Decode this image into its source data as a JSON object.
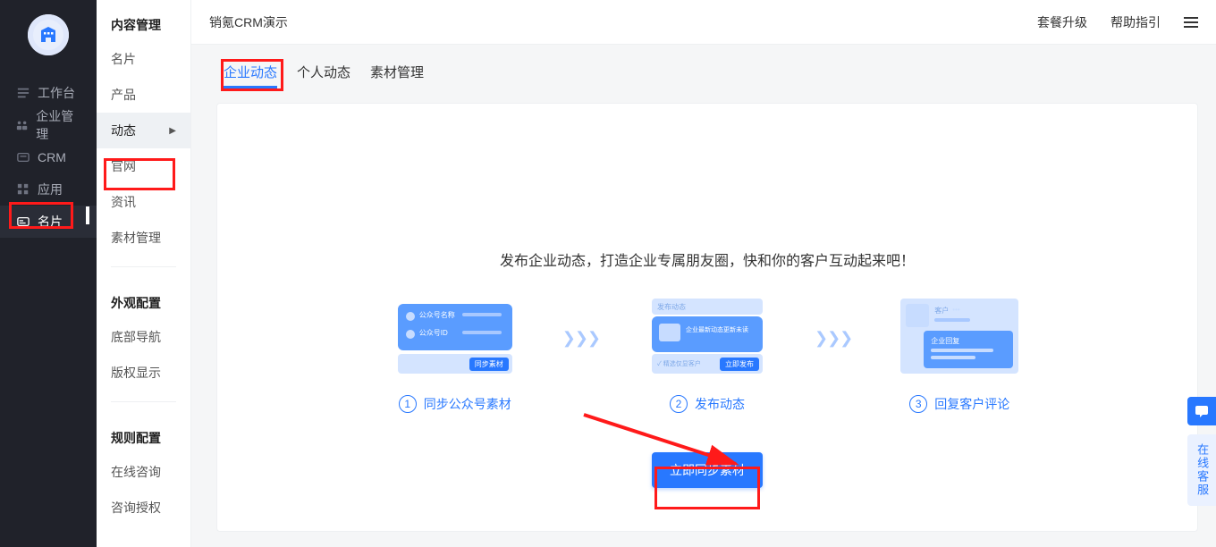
{
  "brand": "销氪CRM演示",
  "top_right": {
    "upgrade": "套餐升级",
    "help": "帮助指引"
  },
  "dark_nav": {
    "workbench": "工作台",
    "enterprise": "企业管理",
    "crm": "CRM",
    "apps": "应用",
    "card": "名片"
  },
  "light_nav": {
    "group_content": "内容管理",
    "card": "名片",
    "product": "产品",
    "dynamic": "动态",
    "site": "官网",
    "news": "资讯",
    "material": "素材管理",
    "group_appearance": "外观配置",
    "bottom_nav": "底部导航",
    "copyright": "版权显示",
    "group_rules": "规则配置",
    "online_chat": "在线咨询",
    "consult_auth": "咨询授权"
  },
  "tabs": {
    "enterprise": "企业动态",
    "personal": "个人动态",
    "material": "素材管理"
  },
  "empty_title": "发布企业动态，打造企业专属朋友圈，快和你的客户互动起来吧！",
  "steps": {
    "s1": {
      "label": "同步公众号素材",
      "num": "1",
      "il_name": "公众号名称",
      "il_id": "公众号ID",
      "il_btn": "同步素材"
    },
    "s2": {
      "label": "发布动态",
      "num": "2",
      "il_title": "发布动态",
      "il_line": "企业最新动态更新未读",
      "il_pick": "精选仅显客户",
      "il_btn": "立即发布"
    },
    "s3": {
      "label": "回复客户评论",
      "num": "3",
      "il_user": "客户",
      "il_badge": "企业回复"
    }
  },
  "cta": "立即同步素材",
  "float": {
    "kefu": "在线客服"
  }
}
